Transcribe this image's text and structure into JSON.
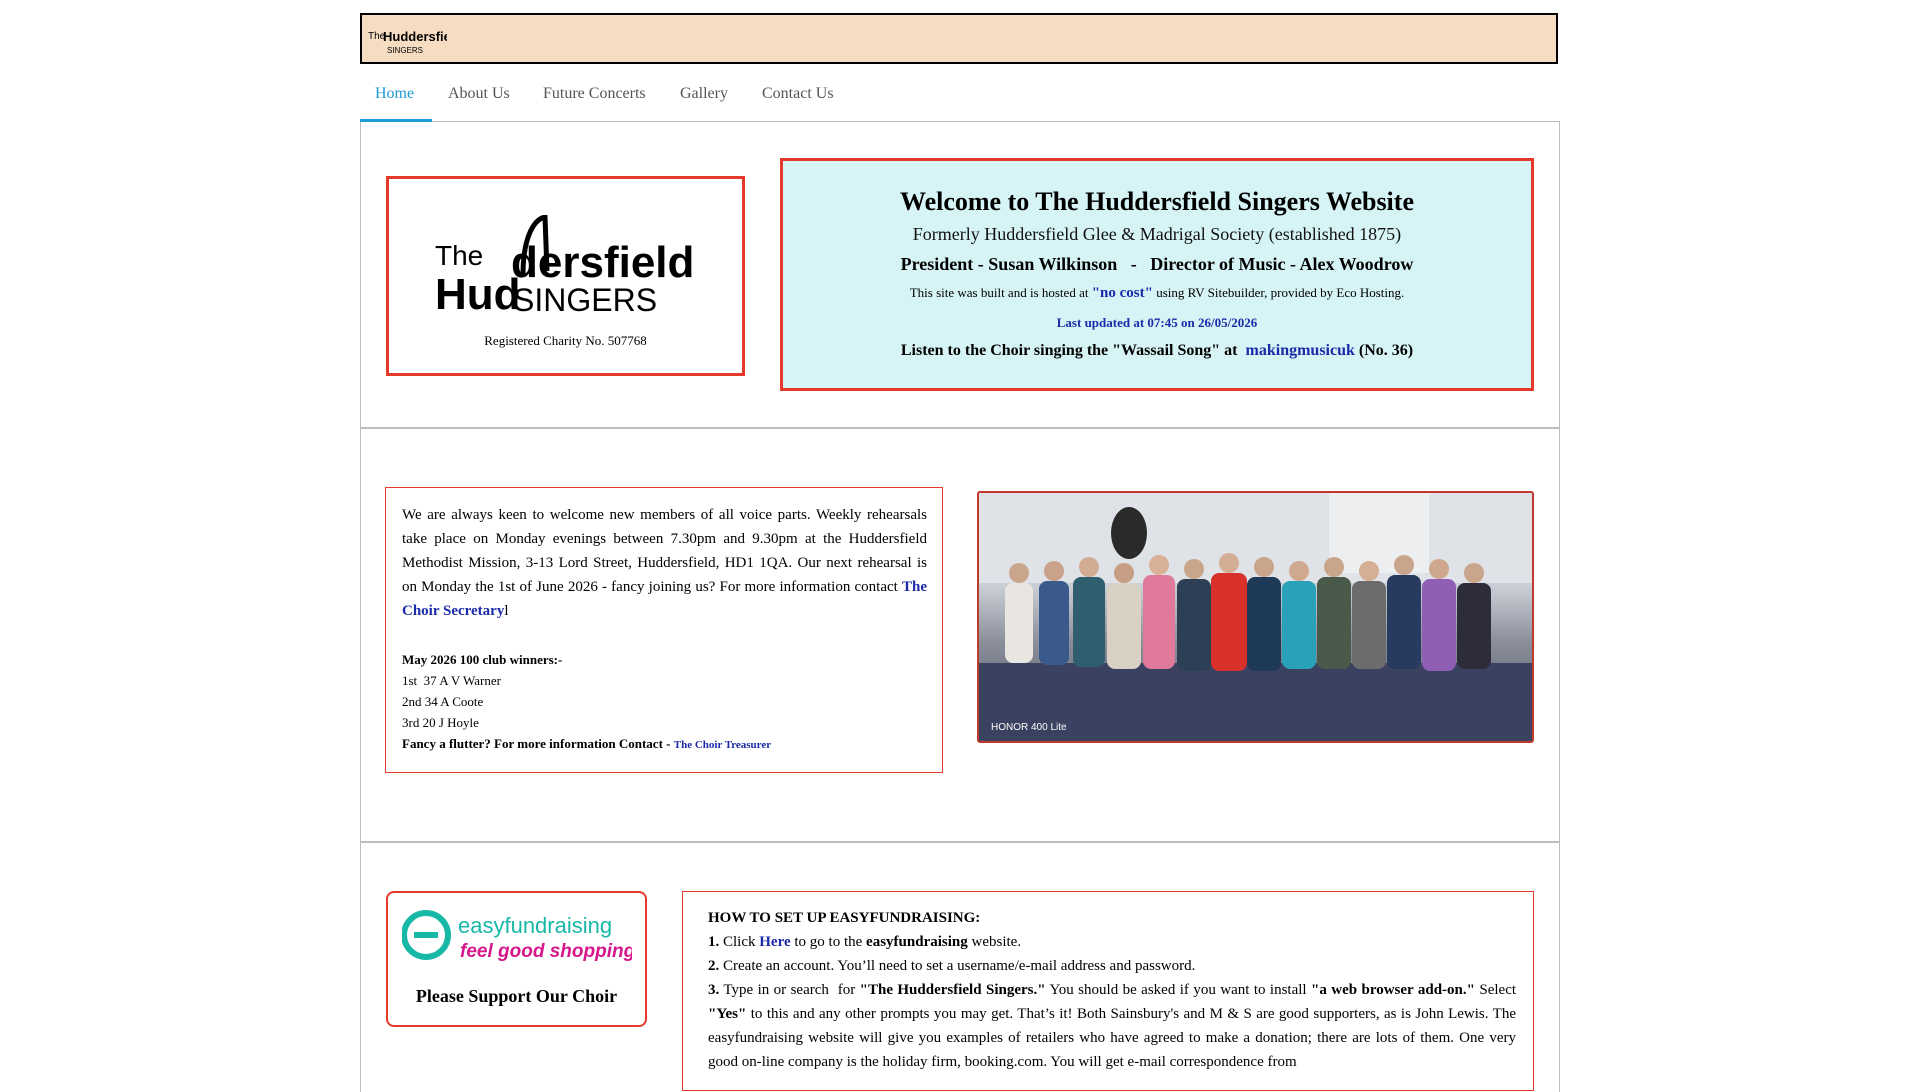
{
  "header": {
    "logo_line1": "The",
    "logo_line1b": "Huddersfield",
    "logo_line2": "SINGERS"
  },
  "nav": [
    {
      "label": "Home"
    },
    {
      "label": "About Us"
    },
    {
      "label": "Future Concerts"
    },
    {
      "label": "Gallery"
    },
    {
      "label": "Contact Us"
    }
  ],
  "logo_box": {
    "logo_the": "The",
    "logo_hud": "Hud",
    "logo_dersfield": "dersfield",
    "logo_singers": "SINGERS",
    "charity": "Registered Charity No. 507768"
  },
  "welcome": {
    "title": "Welcome to The Huddersfield Singers Website",
    "subtitle": "Formerly Huddersfield Glee & Madrigal Society (established 1875)",
    "president": "President - Susan Wilkinson   -   Director of Music - Alex Woodrow",
    "built_pre": "This site was built and is hosted at ",
    "built_nocost": "\"no cost\"",
    "built_post": " using RV Sitebuilder, provided by Eco Hosting.",
    "updated": "Last updated at 07:45 on 26/05/2026",
    "listen_pre": "Listen to the Choir singing the \"Wassail Song\" at  ",
    "listen_link": "makingmusicuk",
    "listen_post": " (No. 36)"
  },
  "info": {
    "text": "We are always keen to welcome new members of all voice parts. Weekly rehearsals take place on Monday evenings between 7.30pm and 9.30pm at the Huddersfield Methodist Mission, 3-13 Lord Street, Huddersfield, HD1 1QA. Our next rehearsal is on Monday the 1st of June 2026 - fancy joining us? For more information contact ",
    "secretary_link": "The Choir Secretary",
    "text_tail": "l",
    "club_heading": "May 2026 100 club winners:-",
    "winners": [
      "1st  37 A V Warner",
      "2nd 34 A Coote",
      "3rd 20 J Hoyle"
    ],
    "flutter": "Fancy a flutter? For more information Contact - ",
    "treasurer_link": "The Choir Treasurer"
  },
  "photo": {
    "caption": "HONOR 400 Lite"
  },
  "easyfundraising": {
    "logo_text1": "easyfundraising",
    "logo_text2": "feel good shopping",
    "caption": "Please Support Our Choir"
  },
  "how": {
    "heading": "HOW TO SET UP EASYFUNDRAISING:",
    "s1_num": "1.",
    "s1_pre": " Click ",
    "s1_link": "Here",
    "s1_mid": " to go to the ",
    "s1_bold": "easyfundraising",
    "s1_post": " website.",
    "s2_num": "2.",
    "s2_text": " Create an account. You’ll need to set a username/e-mail address and password.",
    "s3_num": "3.",
    "s3_pre": " Type in or search  for ",
    "s3_bold1": "\"The Huddersfield Singers.\"",
    "s3_mid": " You should be asked if you want to install ",
    "s3_bold2": "\"a web browser add-on.\"",
    "s3_select": " Select ",
    "s3_yes": "\"Yes\"",
    "s3_tail": " to this and any other prompts you may get. That’s it! Both Sainsbury's and M & S are good supporters, as is John Lewis. The easyfundraising website will give you examples of retailers who have agreed to make a donation; there are lots of them. One very good on-line company is the holiday firm, booking.com. You will get e-mail correspondence from"
  },
  "colors": {
    "accent": "#1e9ad6",
    "border_red": "#e53a2b",
    "link_blue": "#1a2aa8",
    "banner": "#f6dcc0",
    "welcome_bg": "#d6f3f5"
  }
}
